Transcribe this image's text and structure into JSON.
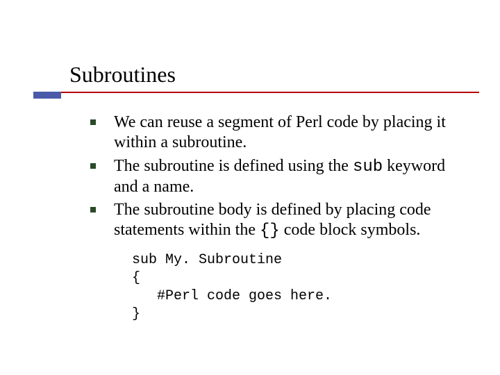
{
  "title": "Subroutines",
  "bullets": [
    {
      "pre": "We can reuse a segment of Perl code by placing it within a subroutine.",
      "code": "",
      "post": ""
    },
    {
      "pre": "The subroutine is defined using the ",
      "code": "sub",
      "post": " keyword and a name."
    },
    {
      "pre": "The subroutine body is defined by placing code statements within the ",
      "code": "{}",
      "post": " code block symbols."
    }
  ],
  "code": {
    "l1": "sub My. Subroutine",
    "l2": "{",
    "l3": "   #Perl code goes here.",
    "l4": "}"
  }
}
